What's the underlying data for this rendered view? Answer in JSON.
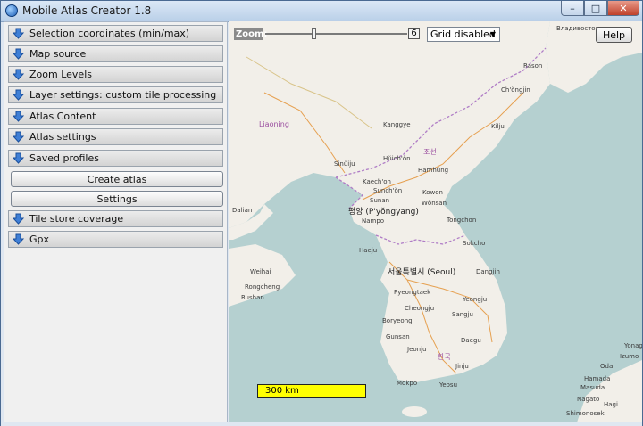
{
  "window": {
    "title": "Mobile Atlas Creator 1.8",
    "min_label": "–",
    "max_label": "□",
    "close_label": "✕"
  },
  "sidebar": {
    "sections": [
      {
        "label": "Selection coordinates (min/max)"
      },
      {
        "label": "Map source"
      },
      {
        "label": "Zoom Levels"
      },
      {
        "label": "Layer settings: custom tile processing"
      },
      {
        "label": "Atlas Content"
      },
      {
        "label": "Atlas settings"
      },
      {
        "label": "Saved profiles"
      }
    ],
    "create_atlas_label": "Create atlas",
    "settings_label": "Settings",
    "sections_bottom": [
      {
        "label": "Tile store coverage"
      },
      {
        "label": "Gpx"
      }
    ]
  },
  "toolbar": {
    "zoom_label": "Zoom:",
    "zoom_value": "6",
    "grid_value": "Grid disabled",
    "help_label": "Help"
  },
  "scale": {
    "label": "300 km"
  },
  "map": {
    "labels": [
      "Владивосток",
      "Rason",
      "Ch'ŏngjin",
      "Kilju",
      "Hamhŭng",
      "Kanggye",
      "Hŭich'ŏn",
      "Sinŭiju",
      "Kaech'on",
      "Sunch'ŏn",
      "Sunan",
      "평양 (P'yŏngyang)",
      "Nampo",
      "Kowon",
      "Wŏnsan",
      "Tongchon",
      "Sokcho",
      "Haeju",
      "서울특별시 (Seoul)",
      "Dangjin",
      "Pyeongtaek",
      "Cheongju",
      "Yeongju",
      "Sangju",
      "Boryeong",
      "Gunsan",
      "Daegu",
      "Jeonju",
      "Jinju",
      "Mokpo",
      "Yeosu",
      "Dalian",
      "Weihai",
      "Rongcheng",
      "Rushan",
      "Liaoning",
      "Hamada",
      "Masuda",
      "Oda",
      "Nagato",
      "Shimonoseki",
      "Izumo",
      "Yonago",
      "Hagi"
    ],
    "countries": [
      "조선",
      "한국"
    ]
  },
  "colors": {
    "accent": "#1d5fb8",
    "scale_bar": "#ffff00",
    "water": "#b5d0d0",
    "land": "#f2efe9"
  }
}
